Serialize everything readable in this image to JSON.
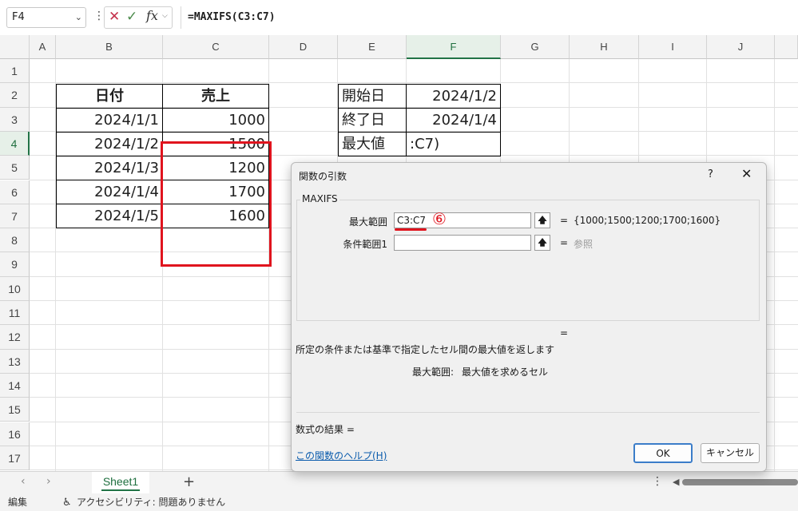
{
  "formula_bar": {
    "name_box": "F4",
    "fx_label": "fx",
    "formula": "=MAXIFS(C3:C7)"
  },
  "sheet": {
    "columns": [
      "A",
      "B",
      "C",
      "D",
      "E",
      "F",
      "G",
      "H",
      "I",
      "J"
    ],
    "rows": [
      "1",
      "2",
      "3",
      "4",
      "5",
      "6",
      "7",
      "8",
      "9",
      "10",
      "11",
      "12",
      "13",
      "14",
      "15",
      "16",
      "17"
    ],
    "table_headers": [
      "日付",
      "売上"
    ],
    "table_rows": [
      {
        "date": "2024/1/1",
        "sales": "1000"
      },
      {
        "date": "2024/1/2",
        "sales": "1500"
      },
      {
        "date": "2024/1/3",
        "sales": "1200"
      },
      {
        "date": "2024/1/4",
        "sales": "1700"
      },
      {
        "date": "2024/1/5",
        "sales": "1600"
      }
    ],
    "criteria": [
      {
        "label": "開始日",
        "value": "2024/1/2"
      },
      {
        "label": "終了日",
        "value": "2024/1/4"
      },
      {
        "label": "最大値",
        "value": ":C7)"
      }
    ]
  },
  "dialog": {
    "title": "関数の引数",
    "help": "?",
    "close": "✕",
    "function_name": "MAXIFS",
    "args": [
      {
        "label": "最大範囲",
        "value": "C3:C7",
        "result": "{1000;1500;1200;1700;1600}"
      },
      {
        "label": "条件範囲1",
        "value": "",
        "result": "参照"
      }
    ],
    "eq": "=",
    "step_mark": "⑥",
    "description": "所定の条件または基準で指定したセル間の最大値を返します",
    "arg_desc_label": "最大範囲:",
    "arg_desc_text": "最大値を求めるセル",
    "result_label": "数式の結果 =",
    "help_link": "この関数のヘルプ(H)",
    "ok": "OK",
    "cancel": "キャンセル"
  },
  "tabs": {
    "sheet_name": "Sheet1",
    "add": "+"
  },
  "status": {
    "mode": "編集",
    "accessibility": "アクセシビリティ: 問題ありません"
  },
  "colors": {
    "excel_green": "#217346",
    "highlight_red": "#e0141e",
    "link_blue": "#0b5cad"
  }
}
